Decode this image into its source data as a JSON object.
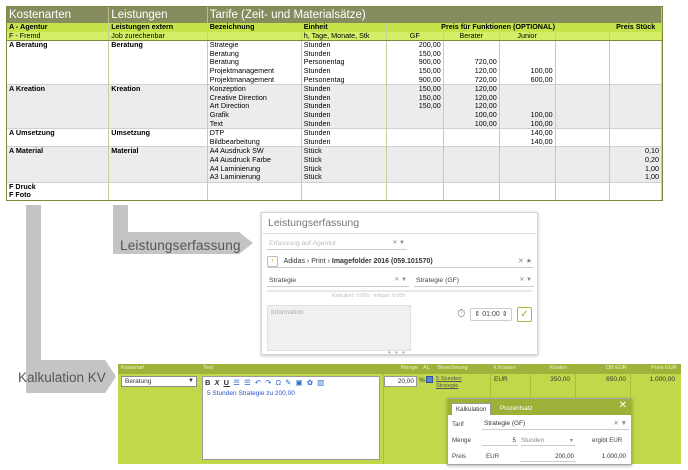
{
  "tariff_table": {
    "header": {
      "kostenarten": "Kostenarten",
      "leistungen": "Leistungen",
      "tarife": "Tarife (Zeit- und Materialsätze)"
    },
    "subheader1": {
      "kostenarten": "A - Agentur",
      "leistungen": "Leistungen extern",
      "bezeichnung": "Bezeichnung",
      "einheit": "Einheit",
      "preis_funktionen": "Preis für Funktionen (OPTIONAL)",
      "preis_stueck": "Preis Stück"
    },
    "subheader2": {
      "kostenarten": "F - Fremd",
      "leistungen": "Job zurechenbar",
      "einheit": "h, Tage, Monate, Stk",
      "gf": "GF",
      "berater": "Berater",
      "junior": "Junior"
    },
    "rows": [
      {
        "k": "A",
        "kostenart": "Beratung",
        "leistung": "Beratung",
        "bez": "Strategie",
        "einheit": "Stunden",
        "gf": "200,00",
        "berater": "",
        "junior": "",
        "stueck": ""
      },
      {
        "k": "",
        "kostenart": "",
        "leistung": "",
        "bez": "Beratung",
        "einheit": "Stunden",
        "gf": "150,00",
        "berater": "",
        "junior": "",
        "stueck": ""
      },
      {
        "k": "",
        "kostenart": "",
        "leistung": "",
        "bez": "Beratung",
        "einheit": "Personentag",
        "gf": "900,00",
        "berater": "720,00",
        "junior": "",
        "stueck": ""
      },
      {
        "k": "",
        "kostenart": "",
        "leistung": "",
        "bez": "Projektmanagement",
        "einheit": "Stunden",
        "gf": "150,00",
        "berater": "120,00",
        "junior": "100,00",
        "stueck": ""
      },
      {
        "k": "",
        "kostenart": "",
        "leistung": "",
        "bez": "Projektmanagement",
        "einheit": "Personentag",
        "gf": "900,00",
        "berater": "720,00",
        "junior": "600,00",
        "stueck": ""
      },
      {
        "k": "A",
        "kostenart": "Kreation",
        "leistung": "Kreation",
        "bez": "Konzeption",
        "einheit": "Stunden",
        "gf": "150,00",
        "berater": "120,00",
        "junior": "",
        "stueck": ""
      },
      {
        "k": "",
        "kostenart": "",
        "leistung": "",
        "bez": "Creative Direction",
        "einheit": "Stunden",
        "gf": "150,00",
        "berater": "120,00",
        "junior": "",
        "stueck": ""
      },
      {
        "k": "",
        "kostenart": "",
        "leistung": "",
        "bez": "Art Direction",
        "einheit": "Stunden",
        "gf": "150,00",
        "berater": "120,00",
        "junior": "",
        "stueck": ""
      },
      {
        "k": "",
        "kostenart": "",
        "leistung": "",
        "bez": "Grafik",
        "einheit": "Stunden",
        "gf": "",
        "berater": "100,00",
        "junior": "100,00",
        "stueck": ""
      },
      {
        "k": "",
        "kostenart": "",
        "leistung": "",
        "bez": "Text",
        "einheit": "Stunden",
        "gf": "",
        "berater": "100,00",
        "junior": "100,00",
        "stueck": ""
      },
      {
        "k": "A",
        "kostenart": "Umsetzung",
        "leistung": "Umsetzung",
        "bez": "DTP",
        "einheit": "Stunden",
        "gf": "",
        "berater": "",
        "junior": "140,00",
        "stueck": ""
      },
      {
        "k": "",
        "kostenart": "",
        "leistung": "",
        "bez": "Bildbearbeitung",
        "einheit": "Stunden",
        "gf": "",
        "berater": "",
        "junior": "140,00",
        "stueck": ""
      },
      {
        "k": "A",
        "kostenart": "Material",
        "leistung": "Material",
        "bez": "A4 Ausdruck SW",
        "einheit": "Stück",
        "gf": "",
        "berater": "",
        "junior": "",
        "stueck": "0,10"
      },
      {
        "k": "",
        "kostenart": "",
        "leistung": "",
        "bez": "A4 Ausdruck Farbe",
        "einheit": "Stück",
        "gf": "",
        "berater": "",
        "junior": "",
        "stueck": "0,20"
      },
      {
        "k": "",
        "kostenart": "",
        "leistung": "",
        "bez": "A4 Laminierung",
        "einheit": "Stück",
        "gf": "",
        "berater": "",
        "junior": "",
        "stueck": "1,00"
      },
      {
        "k": "",
        "kostenart": "",
        "leistung": "",
        "bez": "A3 Laminierung",
        "einheit": "Stück",
        "gf": "",
        "berater": "",
        "junior": "",
        "stueck": "1,00"
      },
      {
        "k": "F",
        "kostenart": "Druck",
        "leistung": "",
        "bez": "",
        "einheit": "",
        "gf": "",
        "berater": "",
        "junior": "",
        "stueck": ""
      },
      {
        "k": "F",
        "kostenart": "Foto",
        "leistung": "",
        "bez": "",
        "einheit": "",
        "gf": "",
        "berater": "",
        "junior": "",
        "stueck": ""
      }
    ]
  },
  "leistungserfassung": {
    "label": "Leistungserfassung",
    "title": "Leistungserfassung",
    "erfassung_placeholder": "Erfassung auf Agentur",
    "breadcrumb": {
      "client": "Adidas",
      "sep1": "›",
      "type": "Print",
      "sep2": "›",
      "job": "Imagefolder 2016 (059.101570)"
    },
    "leistung_select": "Strategie",
    "tarif_select": "Strategie (GF)",
    "hint": "Kalkuliert: 0:00h · erfasst: 0:00h",
    "info_placeholder": "Information",
    "time_value": "01:00",
    "dots": "• • •",
    "timer_icon": "stopwatch-icon",
    "check_icon": "check-icon",
    "accent_color": "#8db52a"
  },
  "kalkulation": {
    "label": "Kalkulation KV",
    "headers": {
      "kostenart": "Kostenart",
      "text": "Text",
      "menge": "Menge",
      "al": "AL",
      "berechnung": "Berechnung",
      "kosten_cur": "k Kosten",
      "kosten": "Kosten",
      "db": "DB EUR",
      "preis": "Preis EUR"
    },
    "kostenart_value": "Beratung",
    "toolbar": {
      "bold": "B",
      "italic": "X",
      "underline": "U",
      "rest": "☰ ☰ ↶ ↷ Ω ✎ ▣ ✿ ▧"
    },
    "text_value": "5 Stunden Strategie zu 200,00",
    "menge_value": "20,00",
    "percent": "%",
    "berechnung_link1": "5 Stunden",
    "berechnung_link2": "Strategie",
    "currency": "EUR",
    "kosten_value": "350,00",
    "db_value": "650,00",
    "preis_value": "1.000,00",
    "gripper": "• • •",
    "popup": {
      "tab_active": "Kalkulation",
      "tab_inactive": "Prozentsatz",
      "close": "✕",
      "tarif_label": "Tarif",
      "tarif_value": "Strategie (GF)",
      "menge_label": "Menge",
      "menge_value": "5",
      "einheit_value": "Stunden",
      "ergibt_label": "ergibt EUR",
      "preis_label": "Preis",
      "preis_cur": "EUR",
      "preis_value": "200,00",
      "ergibt_value": "1.000,00"
    },
    "bg_color": "#bfd94a"
  }
}
